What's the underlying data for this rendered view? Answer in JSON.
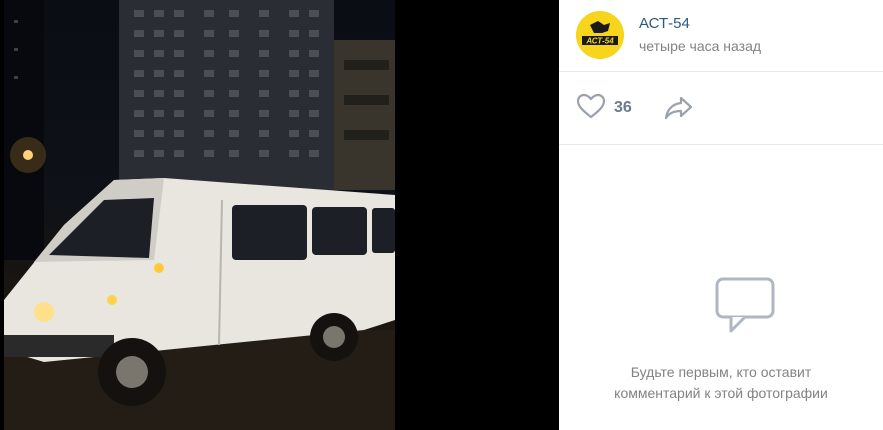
{
  "post": {
    "author": "АСТ-54",
    "time": "четыре часа назад",
    "avatar_logo_text": "АСТ-54"
  },
  "actions": {
    "like_count": "36"
  },
  "comments": {
    "empty_text_line1": "Будьте первым, кто оставит",
    "empty_text_line2": "комментарий к этой фотографии"
  },
  "icons": [
    "heart-icon",
    "share-icon",
    "comments-icon"
  ],
  "colors": {
    "author_link": "#2a5885",
    "avatar_bg": "#f7d51d",
    "icon": "#99a2ad"
  }
}
